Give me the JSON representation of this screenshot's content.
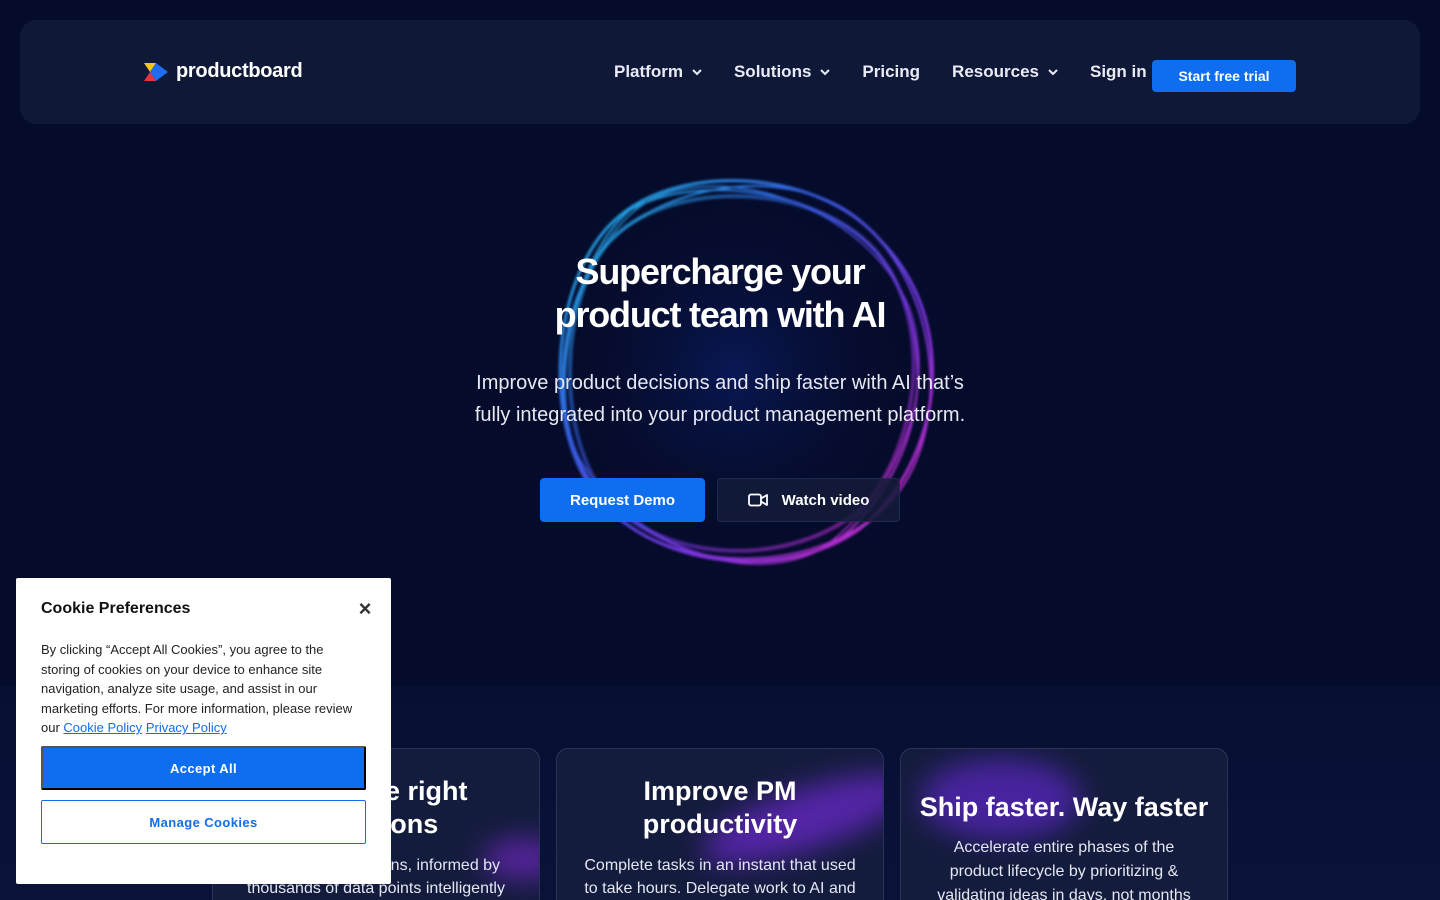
{
  "nav": {
    "logo_text": "productboard",
    "items": [
      {
        "label": "Platform",
        "has_dropdown": true
      },
      {
        "label": "Solutions",
        "has_dropdown": true
      },
      {
        "label": "Pricing",
        "has_dropdown": false
      },
      {
        "label": "Resources",
        "has_dropdown": true
      }
    ],
    "sign_in": "Sign in",
    "cta": "Start free trial"
  },
  "hero": {
    "title_line1": "Supercharge your",
    "title_line2": "product team with AI",
    "subtitle_line1": "Improve product decisions and ship faster with AI that’s",
    "subtitle_line2": "fully integrated into your product management platform.",
    "primary_button": "Request Demo",
    "secondary_button": "Watch video",
    "secondary_icon": "video-camera-icon"
  },
  "features": [
    {
      "title_line1": "Make the right",
      "title_line2": "decisions",
      "body_line1": "Make better decisions, informed by",
      "body_line2": "thousands of data points intelligently"
    },
    {
      "title_line1": "Improve PM",
      "title_line2": "productivity",
      "body_line1": "Complete tasks in an instant that used",
      "body_line2": "to take hours. Delegate work to AI and"
    },
    {
      "title_line1": "Ship faster. Way faster",
      "body_line1": "Accelerate entire phases of the",
      "body_line2": "product lifecycle by prioritizing  &",
      "body_line3": "validating ideas in days, not months"
    }
  ],
  "cookie": {
    "title": "Cookie Preferences",
    "text": "By clicking “Accept All Cookies”, you agree to the storing of cookies on your device to enhance site navigation, analyze site usage, and assist in our marketing efforts. For more information, please review our",
    "cookie_policy_link": "Cookie Policy",
    "privacy_policy_link": "Privacy Policy",
    "accept_button": "Accept All",
    "manage_button": "Manage Cookies"
  },
  "colors": {
    "background": "#050b2a",
    "nav_background": "#0f1836",
    "accent": "#0f6ef0",
    "card_background": "#141c3d"
  }
}
